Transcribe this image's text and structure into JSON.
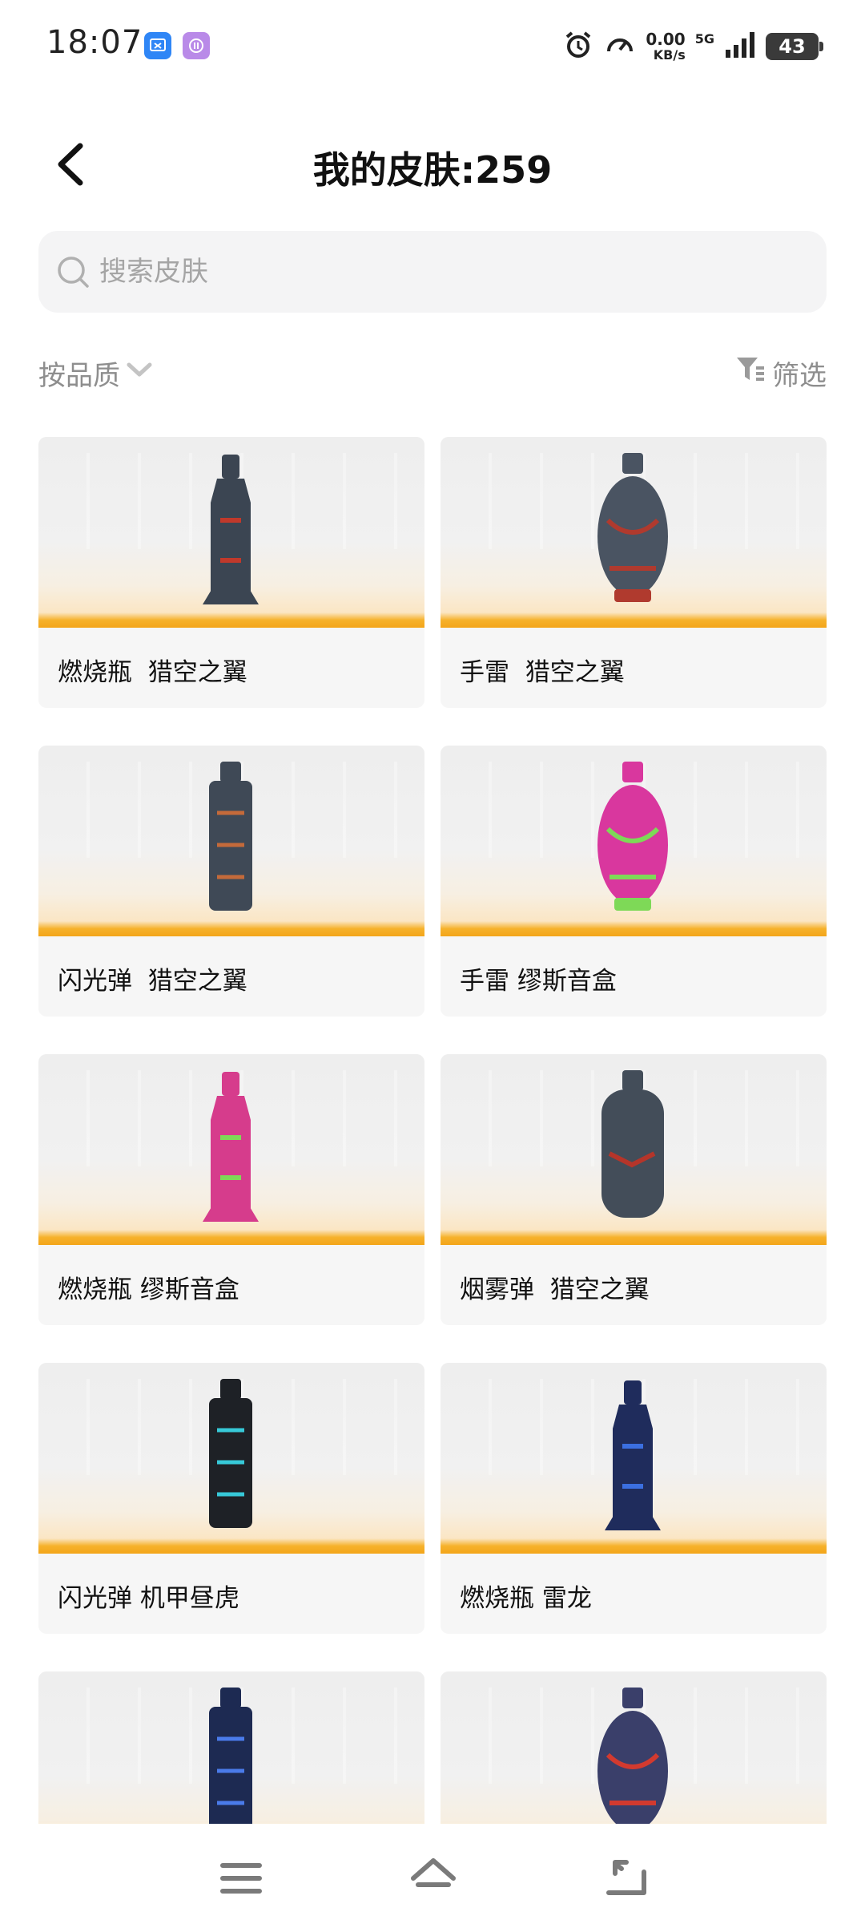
{
  "status_bar": {
    "time": "18:07",
    "net_speed_value": "0.00",
    "net_speed_unit": "KB/s",
    "network": "5G",
    "battery": "43",
    "icons": [
      "app-notification-icon-blue",
      "app-notification-icon-purple",
      "alarm-icon",
      "speedometer-icon",
      "signal-bars-icon"
    ]
  },
  "header": {
    "title": "我的皮肤:259",
    "back_icon": "chevron-left-icon"
  },
  "search": {
    "placeholder": "搜索皮肤",
    "value": "",
    "icon": "search-icon"
  },
  "toolbar": {
    "sort_label": "按品质",
    "sort_icon": "chevron-down-icon",
    "filter_label": "筛选",
    "filter_icon": "funnel-icon"
  },
  "skins": [
    {
      "label": "燃烧瓶  猎空之翼",
      "item_type": "molotov",
      "color": "#3b4552",
      "accent": "#c0392b"
    },
    {
      "label": "手雷  猎空之翼",
      "item_type": "grenade",
      "color": "#4a5462",
      "accent": "#b03a2e"
    },
    {
      "label": "闪光弹  猎空之翼",
      "item_type": "flashbang",
      "color": "#3f4956",
      "accent": "#c46a3a"
    },
    {
      "label": "手雷 缪斯音盒",
      "item_type": "grenade",
      "color": "#d9379e",
      "accent": "#7ed957"
    },
    {
      "label": "燃烧瓶 缪斯音盒",
      "item_type": "molotov",
      "color": "#d63c8c",
      "accent": "#7ed957"
    },
    {
      "label": "烟雾弹  猎空之翼",
      "item_type": "smoke",
      "color": "#434d59",
      "accent": "#b5352a"
    },
    {
      "label": "闪光弹 机甲昼虎",
      "item_type": "flashbang",
      "color": "#1e2126",
      "accent": "#37c9d8"
    },
    {
      "label": "燃烧瓶 雷龙",
      "item_type": "molotov",
      "color": "#1f2c5c",
      "accent": "#3b6fe0"
    },
    {
      "label": "",
      "item_type": "flashbang",
      "color": "#1d2a52",
      "accent": "#4a7bea"
    },
    {
      "label": "",
      "item_type": "grenade",
      "color": "#3a3f6a",
      "accent": "#d23a2f"
    }
  ],
  "nav_bar": {
    "menu_icon": "menu-icon",
    "home_icon": "home-icon",
    "back_icon": "back-icon"
  }
}
